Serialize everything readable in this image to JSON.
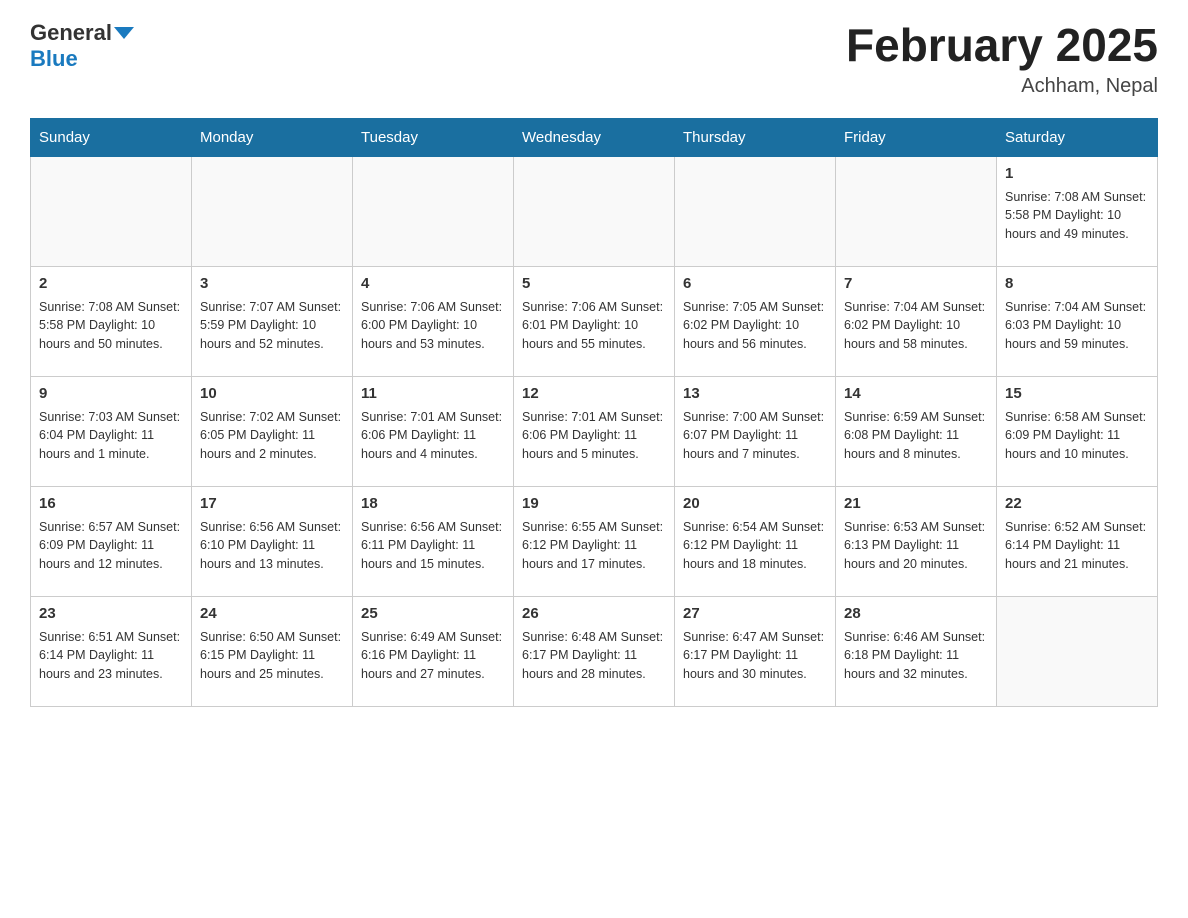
{
  "header": {
    "logo_general": "General",
    "logo_blue": "Blue",
    "title": "February 2025",
    "subtitle": "Achham, Nepal"
  },
  "days_of_week": [
    "Sunday",
    "Monday",
    "Tuesday",
    "Wednesday",
    "Thursday",
    "Friday",
    "Saturday"
  ],
  "weeks": [
    [
      {
        "num": "",
        "info": ""
      },
      {
        "num": "",
        "info": ""
      },
      {
        "num": "",
        "info": ""
      },
      {
        "num": "",
        "info": ""
      },
      {
        "num": "",
        "info": ""
      },
      {
        "num": "",
        "info": ""
      },
      {
        "num": "1",
        "info": "Sunrise: 7:08 AM\nSunset: 5:58 PM\nDaylight: 10 hours\nand 49 minutes."
      }
    ],
    [
      {
        "num": "2",
        "info": "Sunrise: 7:08 AM\nSunset: 5:58 PM\nDaylight: 10 hours\nand 50 minutes."
      },
      {
        "num": "3",
        "info": "Sunrise: 7:07 AM\nSunset: 5:59 PM\nDaylight: 10 hours\nand 52 minutes."
      },
      {
        "num": "4",
        "info": "Sunrise: 7:06 AM\nSunset: 6:00 PM\nDaylight: 10 hours\nand 53 minutes."
      },
      {
        "num": "5",
        "info": "Sunrise: 7:06 AM\nSunset: 6:01 PM\nDaylight: 10 hours\nand 55 minutes."
      },
      {
        "num": "6",
        "info": "Sunrise: 7:05 AM\nSunset: 6:02 PM\nDaylight: 10 hours\nand 56 minutes."
      },
      {
        "num": "7",
        "info": "Sunrise: 7:04 AM\nSunset: 6:02 PM\nDaylight: 10 hours\nand 58 minutes."
      },
      {
        "num": "8",
        "info": "Sunrise: 7:04 AM\nSunset: 6:03 PM\nDaylight: 10 hours\nand 59 minutes."
      }
    ],
    [
      {
        "num": "9",
        "info": "Sunrise: 7:03 AM\nSunset: 6:04 PM\nDaylight: 11 hours\nand 1 minute."
      },
      {
        "num": "10",
        "info": "Sunrise: 7:02 AM\nSunset: 6:05 PM\nDaylight: 11 hours\nand 2 minutes."
      },
      {
        "num": "11",
        "info": "Sunrise: 7:01 AM\nSunset: 6:06 PM\nDaylight: 11 hours\nand 4 minutes."
      },
      {
        "num": "12",
        "info": "Sunrise: 7:01 AM\nSunset: 6:06 PM\nDaylight: 11 hours\nand 5 minutes."
      },
      {
        "num": "13",
        "info": "Sunrise: 7:00 AM\nSunset: 6:07 PM\nDaylight: 11 hours\nand 7 minutes."
      },
      {
        "num": "14",
        "info": "Sunrise: 6:59 AM\nSunset: 6:08 PM\nDaylight: 11 hours\nand 8 minutes."
      },
      {
        "num": "15",
        "info": "Sunrise: 6:58 AM\nSunset: 6:09 PM\nDaylight: 11 hours\nand 10 minutes."
      }
    ],
    [
      {
        "num": "16",
        "info": "Sunrise: 6:57 AM\nSunset: 6:09 PM\nDaylight: 11 hours\nand 12 minutes."
      },
      {
        "num": "17",
        "info": "Sunrise: 6:56 AM\nSunset: 6:10 PM\nDaylight: 11 hours\nand 13 minutes."
      },
      {
        "num": "18",
        "info": "Sunrise: 6:56 AM\nSunset: 6:11 PM\nDaylight: 11 hours\nand 15 minutes."
      },
      {
        "num": "19",
        "info": "Sunrise: 6:55 AM\nSunset: 6:12 PM\nDaylight: 11 hours\nand 17 minutes."
      },
      {
        "num": "20",
        "info": "Sunrise: 6:54 AM\nSunset: 6:12 PM\nDaylight: 11 hours\nand 18 minutes."
      },
      {
        "num": "21",
        "info": "Sunrise: 6:53 AM\nSunset: 6:13 PM\nDaylight: 11 hours\nand 20 minutes."
      },
      {
        "num": "22",
        "info": "Sunrise: 6:52 AM\nSunset: 6:14 PM\nDaylight: 11 hours\nand 21 minutes."
      }
    ],
    [
      {
        "num": "23",
        "info": "Sunrise: 6:51 AM\nSunset: 6:14 PM\nDaylight: 11 hours\nand 23 minutes."
      },
      {
        "num": "24",
        "info": "Sunrise: 6:50 AM\nSunset: 6:15 PM\nDaylight: 11 hours\nand 25 minutes."
      },
      {
        "num": "25",
        "info": "Sunrise: 6:49 AM\nSunset: 6:16 PM\nDaylight: 11 hours\nand 27 minutes."
      },
      {
        "num": "26",
        "info": "Sunrise: 6:48 AM\nSunset: 6:17 PM\nDaylight: 11 hours\nand 28 minutes."
      },
      {
        "num": "27",
        "info": "Sunrise: 6:47 AM\nSunset: 6:17 PM\nDaylight: 11 hours\nand 30 minutes."
      },
      {
        "num": "28",
        "info": "Sunrise: 6:46 AM\nSunset: 6:18 PM\nDaylight: 11 hours\nand 32 minutes."
      },
      {
        "num": "",
        "info": ""
      }
    ]
  ]
}
